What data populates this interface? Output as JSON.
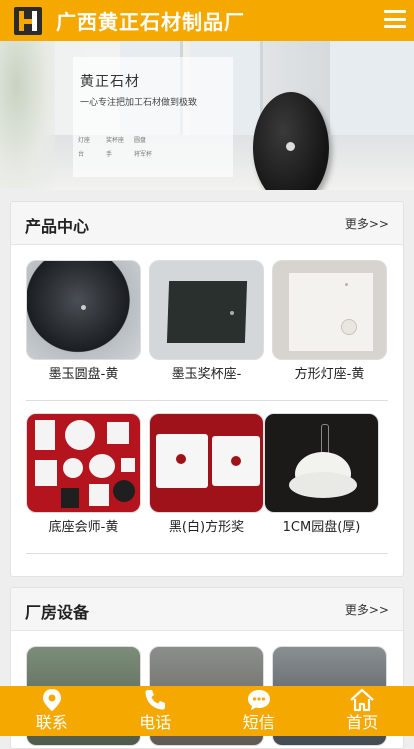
{
  "header": {
    "title": "广西黄正石材制品厂",
    "logo_icon": "logo-icon",
    "menu_icon": "menu-icon"
  },
  "banner": {
    "title": "黄正石材",
    "subtitle": "一心专注把加工石材做到极致",
    "tags": [
      "灯座",
      "奖杯座",
      "圆盘",
      "台",
      "手",
      "将军杯"
    ],
    "slide_count": 3,
    "active_slide": 1
  },
  "products": {
    "title": "产品中心",
    "more": "更多>>",
    "items": [
      {
        "caption": "墨玉圆盘-黄"
      },
      {
        "caption": "墨玉奖杯座-"
      },
      {
        "caption": "方形灯座-黄"
      },
      {
        "caption": "底座会师-黄"
      },
      {
        "caption": "黑(白)方形奖"
      },
      {
        "caption": "1CM园盘(厚)"
      }
    ]
  },
  "factory": {
    "title": "厂房设备",
    "more": "更多>>"
  },
  "bottom_nav": [
    {
      "label": "联系",
      "icon": "location-pin-icon"
    },
    {
      "label": "电话",
      "icon": "phone-icon"
    },
    {
      "label": "短信",
      "icon": "chat-bubble-icon"
    },
    {
      "label": "首页",
      "icon": "home-icon"
    }
  ],
  "colors": {
    "brand": "#f5a800",
    "background": "#eeeeee"
  }
}
